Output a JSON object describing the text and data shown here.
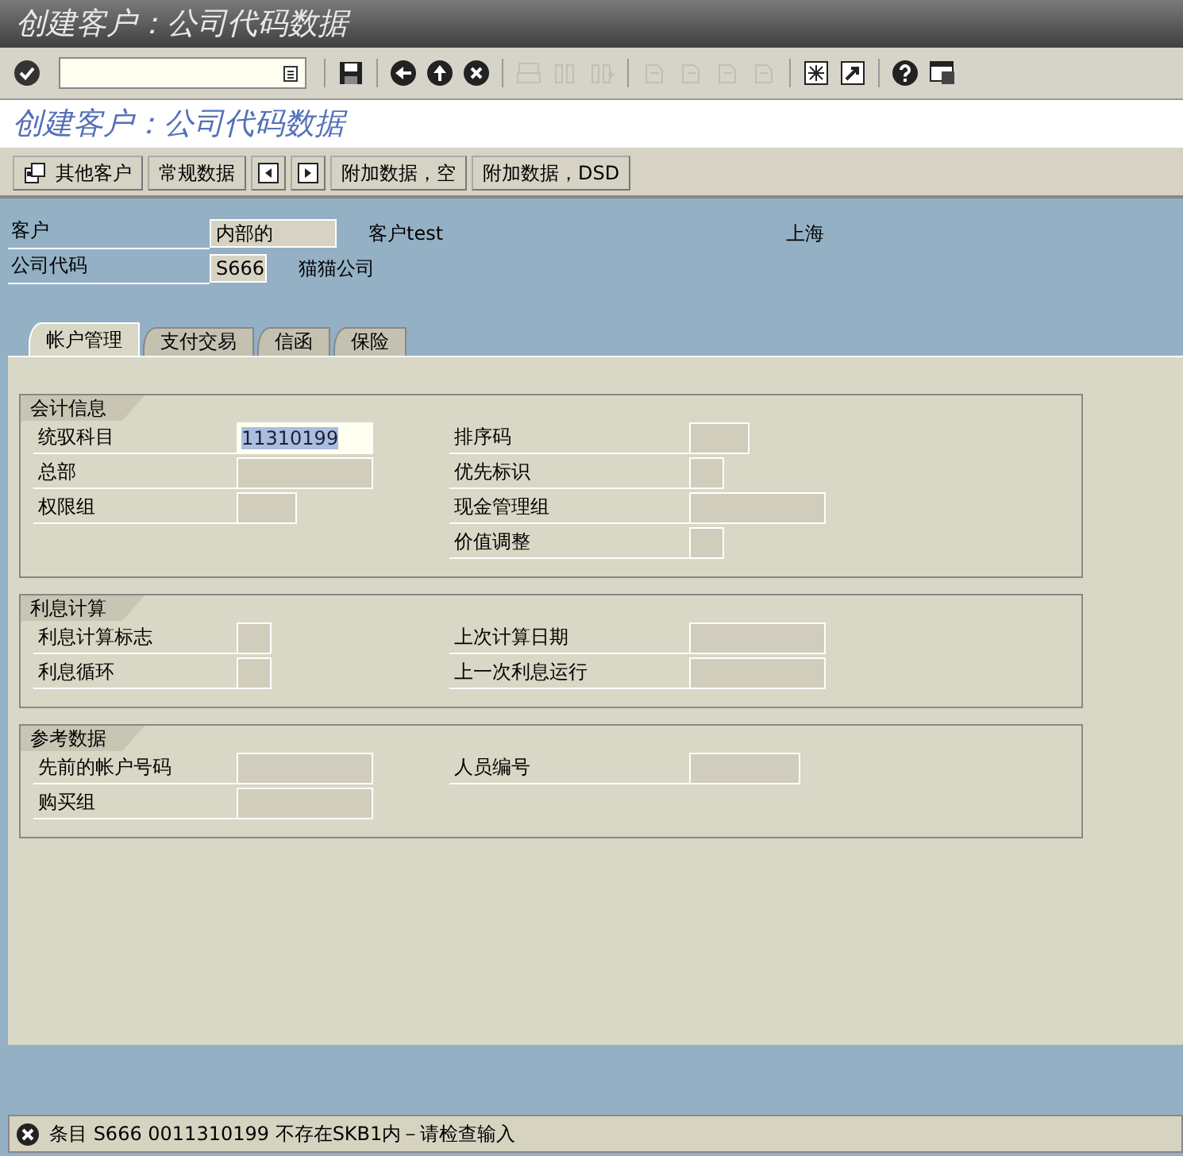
{
  "window": {
    "title": "创建客户：公司代码数据"
  },
  "toolbar": {
    "icons": [
      {
        "kind": "enter",
        "disabled": false
      },
      {
        "kind": "command",
        "disabled": false
      },
      {
        "kind": "save",
        "disabled": false
      },
      {
        "kind": "back",
        "disabled": false
      },
      {
        "kind": "exit",
        "disabled": false
      },
      {
        "kind": "cancel",
        "disabled": false
      },
      {
        "kind": "print",
        "disabled": true
      },
      {
        "kind": "find",
        "disabled": true
      },
      {
        "kind": "findnext",
        "disabled": true
      },
      {
        "kind": "first",
        "disabled": true
      },
      {
        "kind": "prev",
        "disabled": true
      },
      {
        "kind": "next",
        "disabled": true
      },
      {
        "kind": "last",
        "disabled": true
      },
      {
        "kind": "session",
        "disabled": false
      },
      {
        "kind": "shortcut",
        "disabled": false
      },
      {
        "kind": "help",
        "disabled": false
      },
      {
        "kind": "layout",
        "disabled": false
      }
    ]
  },
  "screen_title": "创建客户：公司代码数据",
  "app_toolbar": [
    {
      "kind": "text_icon",
      "label": "其他客户"
    },
    {
      "kind": "text",
      "label": "常规数据"
    },
    {
      "kind": "prev"
    },
    {
      "kind": "next"
    },
    {
      "kind": "text",
      "label": "附加数据，空"
    },
    {
      "kind": "text",
      "label": "附加数据，DSD"
    }
  ],
  "header": [
    {
      "label": "客户",
      "value": "内部的",
      "kind": "medium",
      "description": "客户test",
      "city": "上海"
    },
    {
      "label": "公司代码",
      "value": "S666",
      "kind": "short",
      "description": "猫猫公司"
    }
  ],
  "tabs": [
    {
      "label": "帐户管理",
      "selected": true
    },
    {
      "label": "支付交易",
      "selected": false
    },
    {
      "label": "信函",
      "selected": false
    },
    {
      "label": "保险",
      "selected": false
    }
  ],
  "groups": [
    {
      "title": "会计信息",
      "rows": [
        {
          "left": {
            "label": "统驭科目",
            "value": "11310199",
            "editable": true,
            "kind": "medium"
          },
          "right": {
            "label": "排序码",
            "editable": false,
            "kind": "short"
          }
        },
        {
          "left": {
            "label": "总部",
            "editable": false,
            "kind": "medium"
          },
          "right": {
            "label": "优先标识",
            "editable": false,
            "kind": "tiny"
          }
        },
        {
          "left": {
            "label": "权限组",
            "editable": false,
            "kind": "short"
          },
          "right": {
            "label": "现金管理组",
            "editable": false,
            "kind": "long"
          }
        },
        {
          "right": {
            "label": "价值调整",
            "editable": false,
            "kind": "tiny"
          }
        }
      ]
    },
    {
      "title": "利息计算",
      "rows": [
        {
          "left": {
            "label": "利息计算标志",
            "editable": false,
            "kind": "tiny"
          },
          "right": {
            "label": "上次计算日期",
            "editable": false,
            "kind": "long"
          }
        },
        {
          "left": {
            "label": "利息循环",
            "editable": false,
            "kind": "tiny"
          },
          "right": {
            "label": "上一次利息运行",
            "editable": false,
            "kind": "long"
          }
        }
      ]
    },
    {
      "title": "参考数据",
      "rows": [
        {
          "left": {
            "label": "先前的帐户号码",
            "editable": false,
            "kind": "medium"
          },
          "right": {
            "label": "人员编号",
            "editable": false,
            "kind": "medium2"
          }
        },
        {
          "left": {
            "label": "购买组",
            "editable": false,
            "kind": "medium"
          }
        }
      ]
    }
  ],
  "status_bar": {
    "kind": "error",
    "message": "条目 S666 0011310199 不存在SKB1内－请检查输入"
  }
}
